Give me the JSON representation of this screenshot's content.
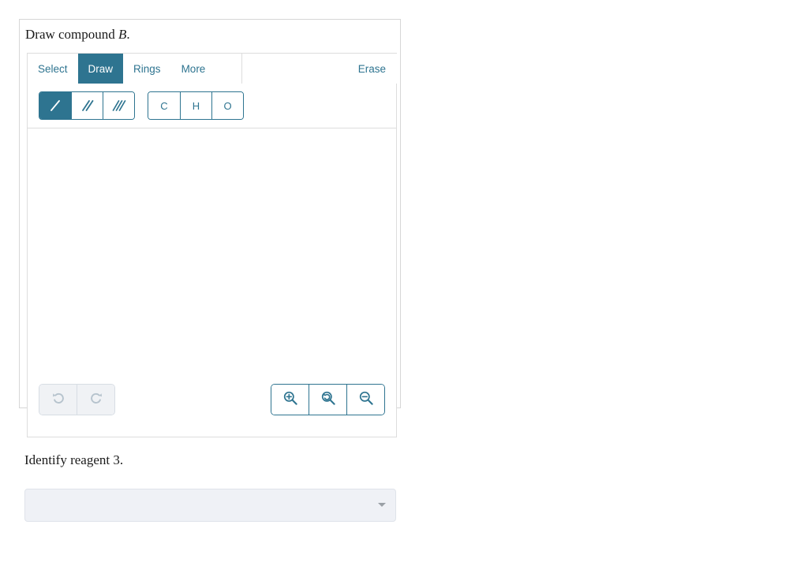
{
  "questions": {
    "draw_prompt_prefix": "Draw compound ",
    "draw_prompt_italic": "B",
    "draw_prompt_suffix": ".",
    "identify_prompt": "Identify reagent 3."
  },
  "sketcher": {
    "tabs": [
      {
        "label": "Select",
        "active": false,
        "name": "tab-select"
      },
      {
        "label": "Draw",
        "active": true,
        "name": "tab-draw"
      },
      {
        "label": "Rings",
        "active": false,
        "name": "tab-rings"
      },
      {
        "label": "More",
        "active": false,
        "name": "tab-more"
      }
    ],
    "erase_label": "Erase",
    "bond_tools": [
      {
        "icon": "single-bond-icon",
        "active": true
      },
      {
        "icon": "double-bond-icon",
        "active": false
      },
      {
        "icon": "triple-bond-icon",
        "active": false
      }
    ],
    "atom_tools": [
      {
        "label": "C",
        "name": "atom-button-carbon"
      },
      {
        "label": "H",
        "name": "atom-button-hydrogen"
      },
      {
        "label": "O",
        "name": "atom-button-oxygen"
      }
    ],
    "history_tools": [
      {
        "icon": "undo-icon",
        "disabled": true
      },
      {
        "icon": "redo-icon",
        "disabled": true
      }
    ],
    "zoom_tools": [
      {
        "icon": "zoom-in-icon"
      },
      {
        "icon": "zoom-reset-icon"
      },
      {
        "icon": "zoom-out-icon"
      }
    ],
    "canvas_content": ""
  },
  "reagent_dropdown": {
    "value": "",
    "placeholder": "",
    "caret_icon": "chevron-down-icon"
  },
  "colors": {
    "accent_teal": "#2e7490",
    "panel_border": "#dddddd",
    "card_border": "#d6d6d6",
    "disabled_bg": "#f0f2f5",
    "disabled_icon": "#b6c3cd",
    "select_bg": "#eff1f6"
  }
}
